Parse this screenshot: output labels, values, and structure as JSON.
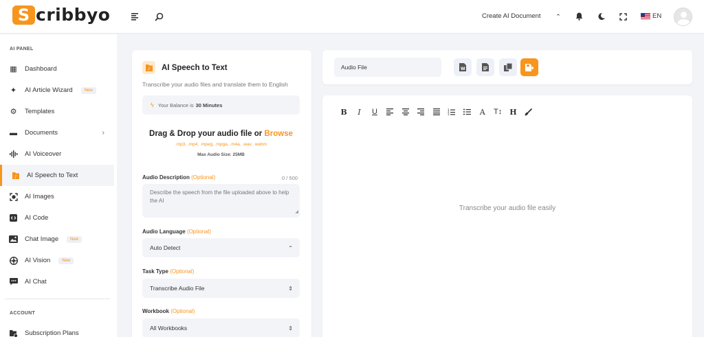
{
  "brand": {
    "logo_letter": "S",
    "name_rest": "cribbyo"
  },
  "header": {
    "create_label": "Create AI Document",
    "lang_label": "EN"
  },
  "sidebar": {
    "panel_label": "AI PANEL",
    "account_label": "ACCOUNT",
    "items": [
      {
        "label": "Dashboard",
        "icon": "dashboard-icon"
      },
      {
        "label": "AI Article Wizard",
        "icon": "sparkle-icon",
        "badge": "New"
      },
      {
        "label": "Templates",
        "icon": "templates-icon"
      },
      {
        "label": "Documents",
        "icon": "folder-icon",
        "chevron": true
      },
      {
        "label": "AI Voiceover",
        "icon": "waveform-icon"
      },
      {
        "label": "AI Speech to Text",
        "icon": "audio-file-icon",
        "active": true
      },
      {
        "label": "AI Images",
        "icon": "image-scan-icon"
      },
      {
        "label": "AI Code",
        "icon": "code-icon"
      },
      {
        "label": "Chat Image",
        "icon": "image-icon",
        "badge": "New"
      },
      {
        "label": "AI Vision",
        "icon": "brain-icon",
        "badge": "New"
      },
      {
        "label": "AI Chat",
        "icon": "chat-icon"
      }
    ],
    "account_items": [
      {
        "label": "Subscription Plans",
        "icon": "subscription-icon"
      }
    ]
  },
  "form": {
    "title": "AI Speech to Text",
    "subtitle": "Transcribe your audio files and translate them to English",
    "balance_prefix": "Your Balance is",
    "balance_value": "30 Minutes",
    "drop_title": "Drag & Drop your audio file or",
    "drop_browse": "Browse",
    "formats": ".mp3, .mp4, .mpeg, .mpga, .m4a, .wav, .webm",
    "max_size": "Max Audio Size: 25MB",
    "description_label": "Audio Description",
    "optional": "(Optional)",
    "description_counter": "0 / 500",
    "description_placeholder": "Describe the speech from the file uploaded above to help the AI",
    "language_label": "Audio Language",
    "language_value": "Auto Detect",
    "task_label": "Task Type",
    "task_value": "Transcribe Audio File",
    "workbook_label": "Workbook",
    "workbook_value": "All Workbooks"
  },
  "toolbar": {
    "file_value": "Audio File"
  },
  "editor": {
    "buttons": [
      "B",
      "I",
      "U",
      "align-left",
      "align-center",
      "align-right",
      "align-justify",
      "ordered-list",
      "bullet-list",
      "A",
      "T↕",
      "H",
      "brush"
    ],
    "placeholder": "Transcribe your audio file easily"
  },
  "colors": {
    "accent": "#f7951d",
    "background": "#f3f4f8",
    "card": "#ffffff"
  }
}
